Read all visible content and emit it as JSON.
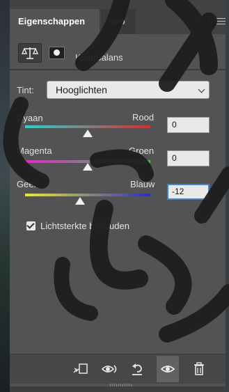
{
  "tabs": [
    {
      "label": "Eigenschappen",
      "active": true
    },
    {
      "label": "Info",
      "active": false
    }
  ],
  "panel": {
    "title": "Kleurbalans",
    "tone": {
      "label": "Tint:",
      "value": "Hooglichten"
    },
    "sliders": [
      {
        "left": "Cyaan",
        "right": "Rood",
        "value": "0",
        "level": 0
      },
      {
        "left": "Magenta",
        "right": "Groen",
        "value": "0",
        "level": 0
      },
      {
        "left": "Geel",
        "right": "Blauw",
        "value": "-12",
        "level": -12,
        "focused": true
      }
    ],
    "preserve_luminosity": {
      "label": "Lichtsterkte behouden",
      "checked": true
    }
  },
  "footer_icons": [
    "clip-to-layer-icon",
    "view-previous-state-icon",
    "reset-icon",
    "visibility-eye-icon",
    "trash-icon"
  ],
  "colors": {
    "panel_bg": "#535353",
    "tab_bar_bg": "#424242",
    "field_bg": "#e9e9e9",
    "focus_border": "#3d84d4",
    "cyan": "#1fd6d0",
    "red": "#e02a2a",
    "magenta": "#ea22d6",
    "green": "#28d83a",
    "yellow": "#ecec2a",
    "blue": "#2c2bc8"
  }
}
